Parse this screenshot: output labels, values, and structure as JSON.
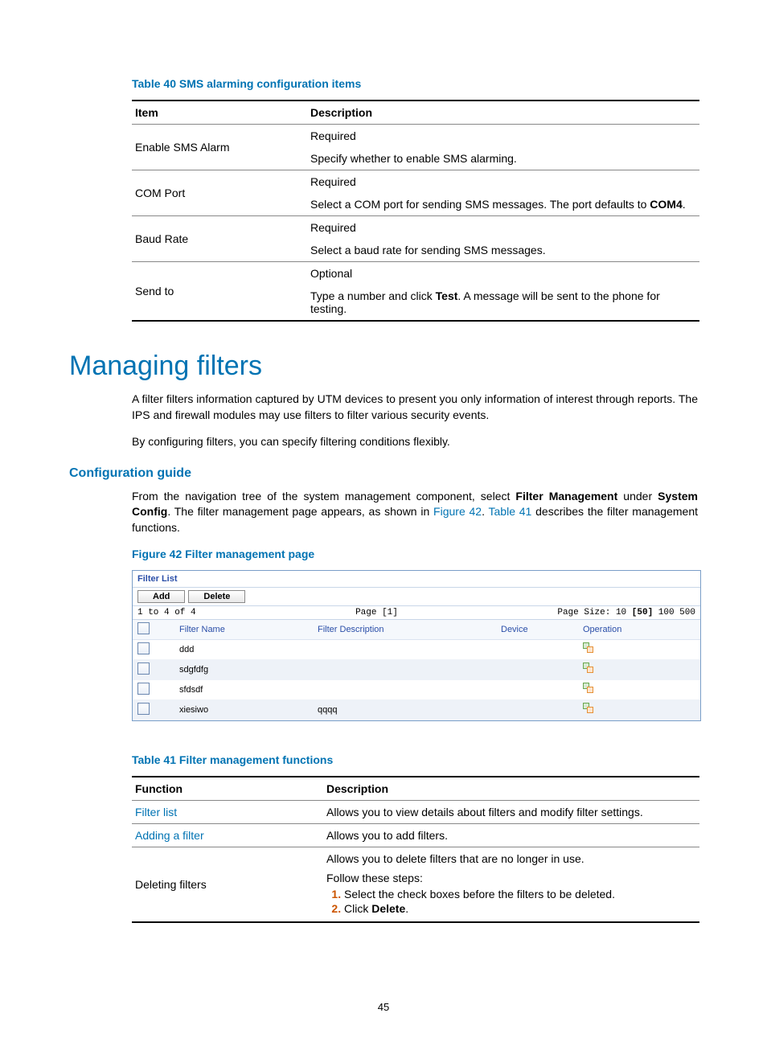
{
  "table40": {
    "caption": "Table 40 SMS alarming configuration items",
    "headers": {
      "col1": "Item",
      "col2": "Description"
    },
    "rows": [
      {
        "item": "Enable SMS Alarm",
        "l1": "Required",
        "l2_pre": "Specify whether to enable SMS alarming.",
        "l2_bold": "",
        "l2_post": ""
      },
      {
        "item": "COM Port",
        "l1": "Required",
        "l2_pre": "Select a COM port for sending SMS messages. The port defaults to ",
        "l2_bold": "COM4",
        "l2_post": "."
      },
      {
        "item": "Baud Rate",
        "l1": "Required",
        "l2_pre": "Select a baud rate for sending SMS messages.",
        "l2_bold": "",
        "l2_post": ""
      },
      {
        "item": "Send to",
        "l1": "Optional",
        "l2_pre": "Type a number and click ",
        "l2_bold": "Test",
        "l2_post": ". A message will be sent to the phone for testing."
      }
    ]
  },
  "section": {
    "title": "Managing filters",
    "para1": "A filter filters information captured by UTM devices to present you only information of interest through reports. The IPS and firewall modules may use filters to filter various security events.",
    "para2": "By configuring filters, you can specify filtering conditions flexibly."
  },
  "guide": {
    "heading": "Configuration guide",
    "p_pre": "From the navigation tree of the system management component, select ",
    "fm": "Filter Management",
    "p_mid1": " under ",
    "sc": "System Config",
    "p_mid2": ". The filter management page appears, as shown in ",
    "figref": "Figure 42",
    "p_mid3": ". ",
    "tabref": "Table 41",
    "p_post": " describes the filter management functions.",
    "figcap": "Figure 42 Filter management page"
  },
  "embed": {
    "title": "Filter List",
    "add": "Add",
    "delete": "Delete",
    "count": "1 to 4 of 4",
    "page": "Page [1]",
    "sizes_pre": "Page Size: 10 ",
    "sizes_sel": "[50]",
    "sizes_post": " 100 500",
    "cols": {
      "c1": "Filter Name",
      "c2": "Filter Description",
      "c3": "Device",
      "c4": "Operation"
    },
    "rows": [
      {
        "name": "ddd",
        "desc": ""
      },
      {
        "name": "sdgfdfg",
        "desc": ""
      },
      {
        "name": "sfdsdf",
        "desc": ""
      },
      {
        "name": "xiesiwo",
        "desc": "qqqq"
      }
    ]
  },
  "table41": {
    "caption": "Table 41 Filter management functions",
    "headers": {
      "col1": "Function",
      "col2": "Description"
    },
    "r1": {
      "f": "Filter list",
      "d": "Allows you to view details about filters and modify filter settings."
    },
    "r2": {
      "f": "Adding a filter",
      "d": "Allows you to add filters."
    },
    "r3": {
      "f": "Deleting filters",
      "d1": "Allows you to delete filters that are no longer in use.",
      "d2": "Follow these steps:",
      "s1": "Select the check boxes before the filters to be deleted.",
      "s2_pre": "Click ",
      "s2_bold": "Delete",
      "s2_post": "."
    }
  },
  "pagenum": "45"
}
